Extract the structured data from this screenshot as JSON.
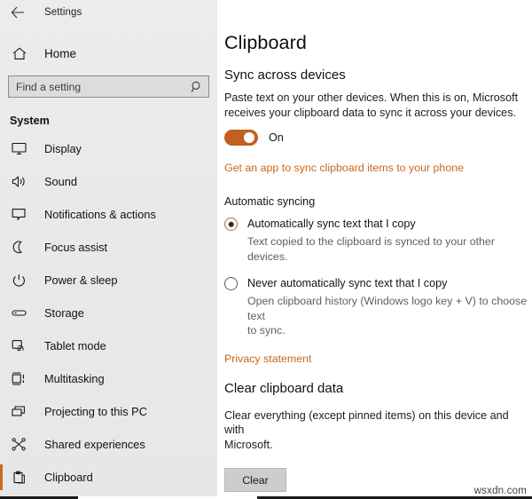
{
  "window": {
    "titlebar_label": "Settings",
    "back_icon": "back-arrow-icon"
  },
  "sidebar": {
    "home_label": "Home",
    "home_icon": "home-icon",
    "search": {
      "placeholder": "Find a setting",
      "value": "",
      "icon": "search-icon"
    },
    "group_title": "System",
    "items": [
      {
        "label": "Display",
        "icon": "monitor-icon",
        "selected": false
      },
      {
        "label": "Sound",
        "icon": "speaker-icon",
        "selected": false
      },
      {
        "label": "Notifications & actions",
        "icon": "notification-icon",
        "selected": false
      },
      {
        "label": "Focus assist",
        "icon": "moon-icon",
        "selected": false
      },
      {
        "label": "Power & sleep",
        "icon": "power-icon",
        "selected": false
      },
      {
        "label": "Storage",
        "icon": "storage-icon",
        "selected": false
      },
      {
        "label": "Tablet mode",
        "icon": "tablet-icon",
        "selected": false
      },
      {
        "label": "Multitasking",
        "icon": "multitasking-icon",
        "selected": false
      },
      {
        "label": "Projecting to this PC",
        "icon": "projecting-icon",
        "selected": false
      },
      {
        "label": "Shared experiences",
        "icon": "share-icon",
        "selected": false
      },
      {
        "label": "Clipboard",
        "icon": "clipboard-icon",
        "selected": true
      }
    ]
  },
  "main": {
    "page_title": "Clipboard",
    "sync_section": {
      "title": "Sync across devices",
      "description": "Paste text on your other devices. When this is on, Microsoft\nreceives your clipboard data to sync it across your devices.",
      "toggle_state": "On",
      "toggle_on": true,
      "app_link": "Get an app to sync clipboard items to your phone"
    },
    "auto_sync": {
      "heading": "Automatic syncing",
      "option_1_label": "Automatically sync text that I copy",
      "option_1_desc": "Text copied to the clipboard is synced to your other devices.",
      "option_1_selected": true,
      "option_2_label": "Never automatically sync text that I copy",
      "option_2_desc": "Open clipboard history (Windows logo key + V) to choose text\nto sync.",
      "option_2_selected": false,
      "privacy_link": "Privacy statement"
    },
    "clear_section": {
      "title": "Clear clipboard data",
      "description": "Clear everything (except pinned items) on this device and with\nMicrosoft.",
      "button_label": "Clear"
    }
  },
  "watermark": "wsxdn.com",
  "colors": {
    "accent": "#c9671e",
    "toggle_on": "#c1601f",
    "sidebar_bg": "#ececed",
    "content_bg": "#ffffff"
  }
}
